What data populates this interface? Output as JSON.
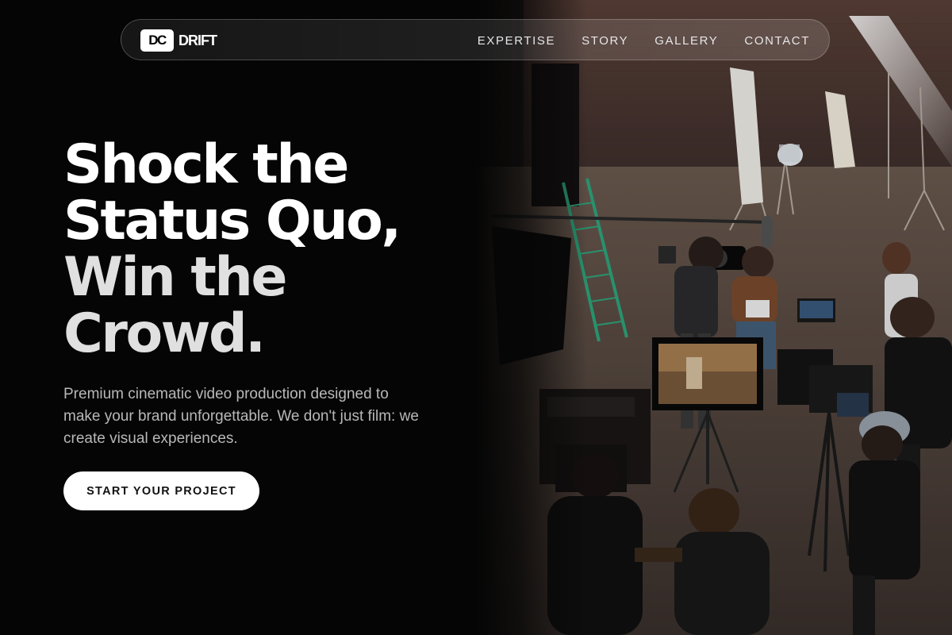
{
  "brand": {
    "mark": "DC",
    "name": "DRIFT"
  },
  "nav": {
    "links": [
      "EXPERTISE",
      "STORY",
      "GALLERY",
      "CONTACT"
    ]
  },
  "hero": {
    "headline": [
      "Shock the",
      "Status Quo,",
      "Win the",
      "Crowd."
    ],
    "lede": "Premium cinematic video production designed to make your brand unforgettable. We don't just film: we create visual experiences.",
    "cta_label": "START YOUR PROJECT"
  },
  "colors": {
    "background": "#050505",
    "text": "#ffffff",
    "muted": "#b8b8b8",
    "cta_bg": "#ffffff",
    "cta_text": "#111111"
  }
}
